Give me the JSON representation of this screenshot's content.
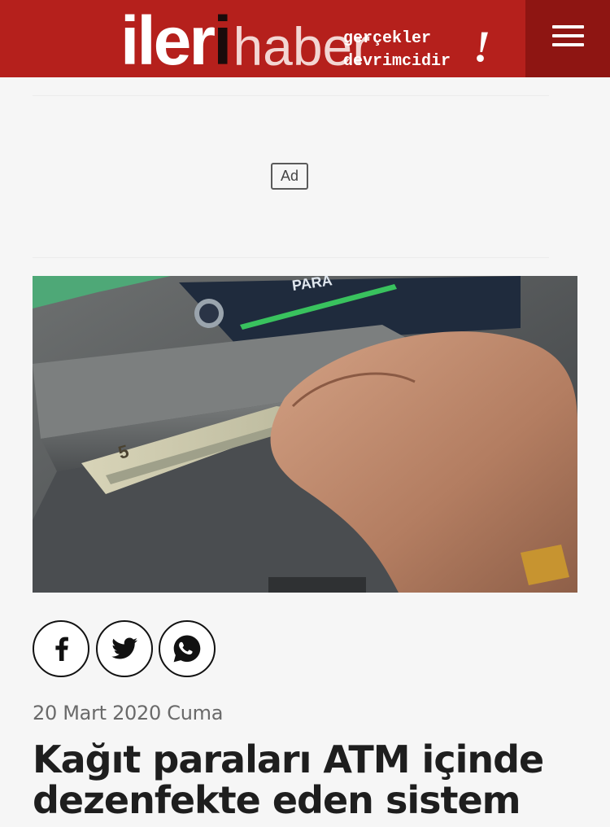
{
  "header": {
    "logo_part1": "ileri",
    "logo_accent": "i",
    "logo_part2": "haber",
    "tagline_line1": "gerçekler",
    "tagline_line2": "devrimcidir",
    "tagline_mark": "!",
    "brand_color": "#b5201c",
    "menu_icon": "hamburger-menu-icon"
  },
  "ad": {
    "label": "Ad"
  },
  "share": {
    "facebook_icon": "facebook-icon",
    "twitter_icon": "twitter-icon",
    "whatsapp_icon": "whatsapp-icon"
  },
  "article": {
    "date": "20 Mart 2020 Cuma",
    "title": "Kağıt paraları ATM içinde dezenfekte eden sistem"
  }
}
